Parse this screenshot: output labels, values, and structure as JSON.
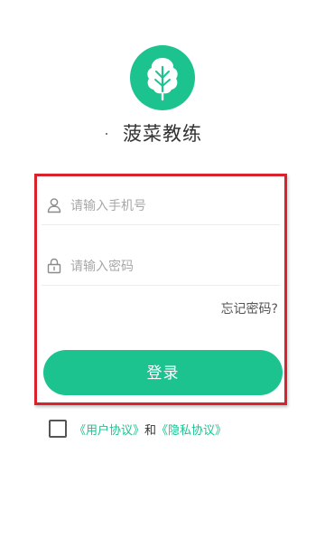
{
  "app": {
    "name": "菠菜教练",
    "logo_icon": "leaf-icon",
    "brand_color": "#1cc38f"
  },
  "form": {
    "phone": {
      "placeholder": "请输入手机号",
      "value": "",
      "icon": "user-icon"
    },
    "password": {
      "placeholder": "请输入密码",
      "value": "",
      "icon": "lock-icon"
    },
    "forgot_label": "忘记密码?",
    "login_label": "登录",
    "highlight_color": "#d9232c"
  },
  "agreement": {
    "checked": false,
    "user_agreement": "《用户协议》",
    "and": "和",
    "privacy_policy": "《隐私协议》"
  }
}
